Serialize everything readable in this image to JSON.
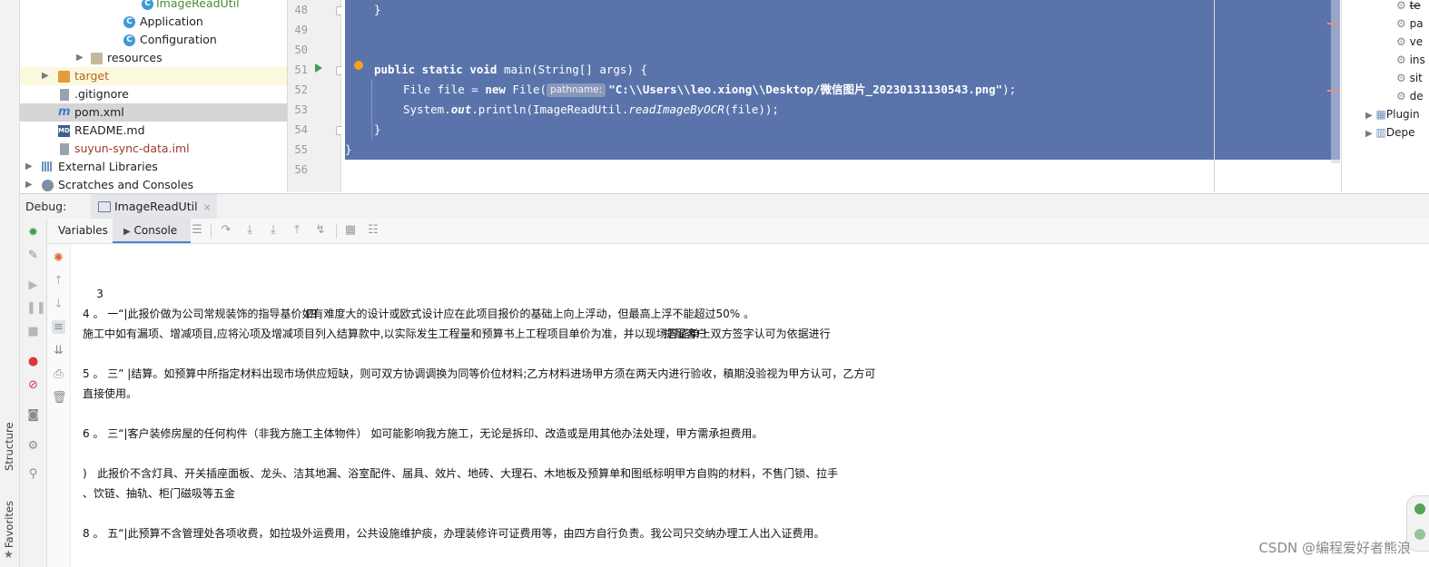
{
  "project_tree": {
    "items": [
      {
        "label": "ImageReadUtil",
        "kind": "class"
      },
      {
        "label": "Application",
        "kind": "class"
      },
      {
        "label": "Configuration",
        "kind": "class"
      },
      {
        "label": "resources",
        "kind": "folder"
      },
      {
        "label": "target",
        "kind": "folder-orange"
      },
      {
        "label": ".gitignore",
        "kind": "file"
      },
      {
        "label": "pom.xml",
        "kind": "maven"
      },
      {
        "label": "README.md",
        "kind": "md"
      },
      {
        "label": "suyun-sync-data.iml",
        "kind": "iml"
      },
      {
        "label": "External Libraries",
        "kind": "library"
      },
      {
        "label": "Scratches and Consoles",
        "kind": "scratch"
      }
    ]
  },
  "editor": {
    "line_numbers": [
      "48",
      "49",
      "50",
      "51",
      "52",
      "53",
      "54",
      "55",
      "56"
    ],
    "lines": {
      "l48": "}",
      "l51_mod": "public static void ",
      "l51_rest": "main(String[] args) {",
      "l52_a": "File file = ",
      "l52_new": "new ",
      "l52_b": "File(",
      "l52_hint": "pathname:",
      "l52_str": "\"C:\\\\Users\\\\leo.xiong\\\\Desktop/微信图片_20230131130543.png\"",
      "l52_end": ");",
      "l53_a": "System.",
      "l53_out": "out",
      "l53_b": ".println(ImageReadUtil.",
      "l53_method": "readImageByOCR",
      "l53_c": "(file));",
      "l54": "}",
      "l55": "}"
    }
  },
  "maven_panel": {
    "items": [
      "te",
      "pa",
      "ve",
      "ins",
      "sit",
      "de"
    ],
    "groups": [
      "Plugin",
      "Depe"
    ]
  },
  "debug": {
    "title": "Debug:",
    "session_tab": "ImageReadUtil",
    "close_glyph": "×",
    "sub_tabs": {
      "variables": "Variables",
      "console": "Console"
    }
  },
  "console": {
    "row1": {
      "a": "3",
      "b": "四",
      "c": "提醒客户"
    },
    "lines": [
      "4 。 一“|此报价做为公司常规装饰的指导基价如有难度大的设计或欧式设计应在此项目报价的基础上向上浮动，但最高上浮不能超过50% 。",
      "施工中如有漏项、增减项目,应将沁项及增减项目列入结算款中,以实际发生工程量和预算书上工程项目单价为准，并以现场答证单上双方签字认可为依据进行",
      "5 。 三” |结算。如预算中所指定材料出现市场供应短缺，则可双方协调调换为同等价位材料;乙方材料进场甲方须在两天内进行验收，稹期没验视为甲方认可，乙方可",
      "直接使用。",
      "6 。 三“|客户装修房屋的任何构件（非我方施工主体物件） 如可能影响我方施工，无论是拆印、改造或是用其他办法处理，甲方需承担费用。",
      ")   此报价不含灯具、开关插座面板、龙头、洁其地漏、浴室配件、届具、效片、地砖、大理石、木地板及预算单和图纸标明甲方自购的材料，不售门锁、拉手",
      "、饮链、抽轨、柜门磁吸等五金",
      "8 。 五“|此预算不含管理处各项收费，如拉圾外运费用，公共设施维护痰，办理装修许可证费用等，由四方自行负责。我公司只交纳办理工人出入证费用。"
    ]
  },
  "side_tabs": {
    "structure": "Structure",
    "favorites": "Favorites"
  },
  "watermark": "CSDN @编程爱好者熊浪",
  "colors": {
    "selection": "#5a74ab",
    "accent": "#4a83d1",
    "run": "#3ea24a",
    "breakpoint": "#f2a31b"
  }
}
